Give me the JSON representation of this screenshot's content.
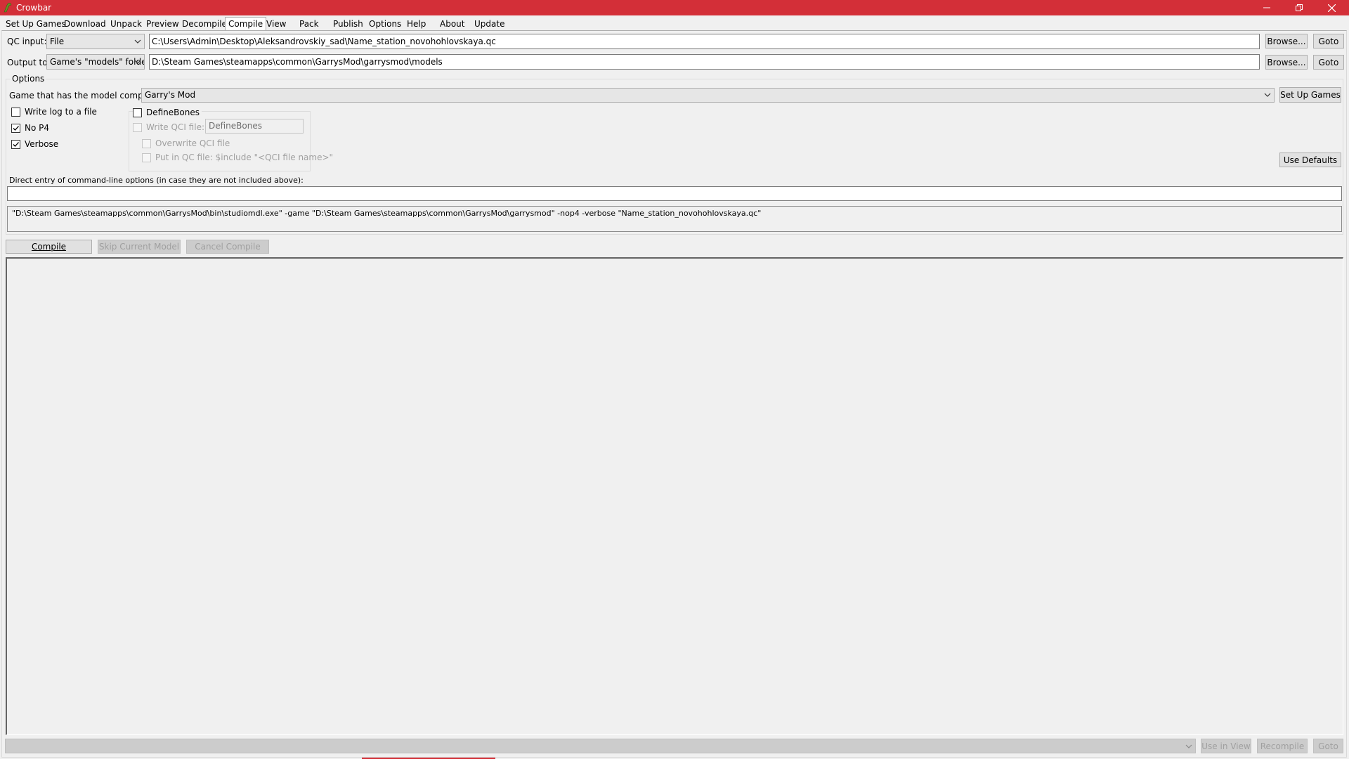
{
  "window": {
    "title": "Crowbar",
    "accent_color": "#d32f38"
  },
  "tabs": [
    {
      "label": "Set Up Games"
    },
    {
      "label": "Download"
    },
    {
      "label": "Unpack"
    },
    {
      "label": "Preview"
    },
    {
      "label": "Decompile"
    },
    {
      "label": "Compile",
      "active": true
    },
    {
      "label": "View"
    },
    {
      "label": "Pack"
    },
    {
      "label": "Publish"
    },
    {
      "label": "Options"
    },
    {
      "label": "Help"
    },
    {
      "label": "About"
    },
    {
      "label": "Update"
    }
  ],
  "qc_input": {
    "label": "QC input:",
    "mode": "File",
    "path": "C:\\Users\\Admin\\Desktop\\Aleksandrovskiy_sad\\Name_station_novohohlovskaya.qc",
    "browse_label": "Browse...",
    "goto_label": "Goto"
  },
  "output_to": {
    "label": "Output to:",
    "mode": "Game's \"models\" folde",
    "path": "D:\\Steam Games\\steamapps\\common\\GarrysMod\\garrysmod\\models",
    "browse_label": "Browse...",
    "goto_label": "Goto"
  },
  "options": {
    "title": "Options",
    "game_label": "Game that has the model compiler:",
    "game_value": "Garry's Mod",
    "setup_games_label": "Set Up Games",
    "write_log": {
      "label": "Write log to a file",
      "checked": false
    },
    "no_p4": {
      "label": "No P4",
      "checked": true
    },
    "verbose": {
      "label": "Verbose",
      "checked": true
    },
    "define_bones": {
      "label": "DefineBones",
      "checked": false
    },
    "write_qci": {
      "label": "Write QCI file:",
      "checked": false,
      "value": "DefineBones"
    },
    "overwrite_qci": {
      "label": "Overwrite QCI file",
      "checked": false
    },
    "put_in_qc": {
      "label": "Put in QC file: $include \"<QCI file name>\"",
      "checked": false
    },
    "use_defaults_label": "Use Defaults",
    "direct_entry_label": "Direct entry of command-line options (in case they are not included above):",
    "direct_entry_value": "",
    "command_line": "\"D:\\Steam Games\\steamapps\\common\\GarrysMod\\bin\\studiomdl.exe\" -game \"D:\\Steam Games\\steamapps\\common\\GarrysMod\\garrysmod\" -nop4 -verbose \"Name_station_novohohlovskaya.qc\""
  },
  "actions": {
    "compile_label": "Compile",
    "skip_label": "Skip Current Model",
    "cancel_label": "Cancel Compile"
  },
  "bottom": {
    "use_in_view_label": "Use in View",
    "recompile_label": "Recompile",
    "goto_label": "Goto"
  }
}
